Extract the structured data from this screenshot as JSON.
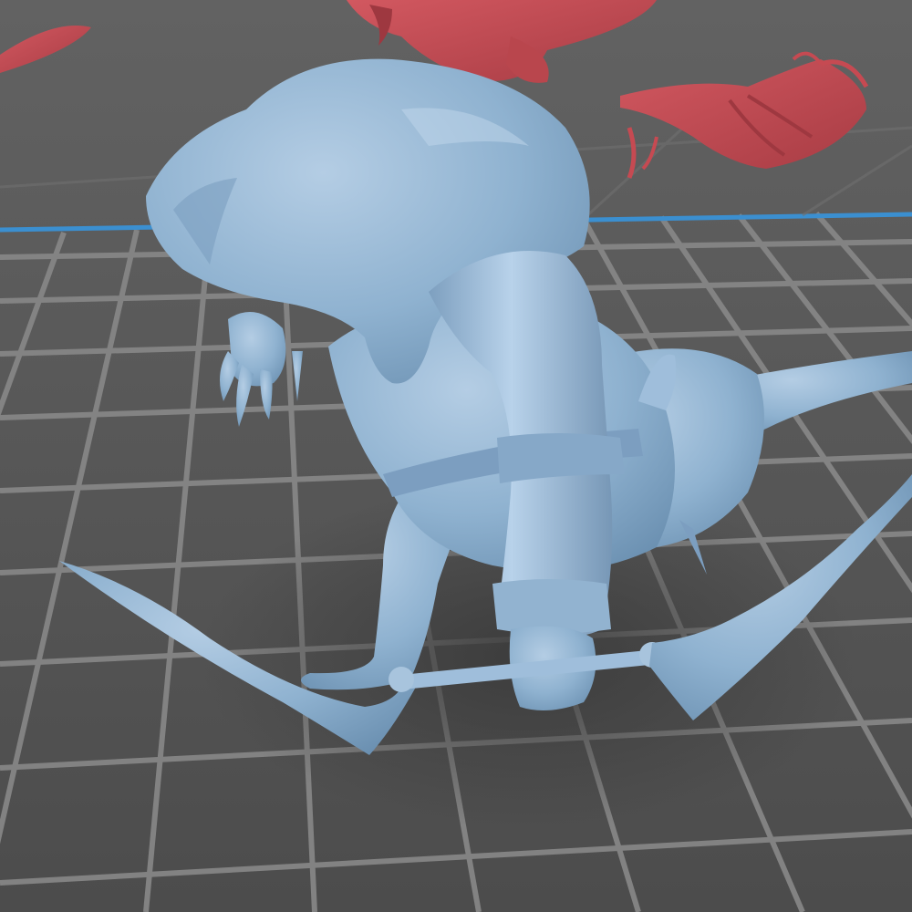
{
  "scene": {
    "colors": {
      "background_far": "#5c5c5c",
      "background_near": "#4a4a4a",
      "grid_line": "#8a8a8a",
      "build_plate_edge": "#3b8fd0",
      "model_selected": "#8fb2d0",
      "model_selected_shade": "#6f93b4",
      "model_selected_highlight": "#bcd4e8",
      "model_other": "#c64a52",
      "model_other_shade": "#9e3840",
      "shadow": "#3e3e3e"
    },
    "icons": {
      "grid": "build-plate-grid",
      "selected_model": "goblin-archer-miniature",
      "background_models": "red-miniatures"
    }
  }
}
